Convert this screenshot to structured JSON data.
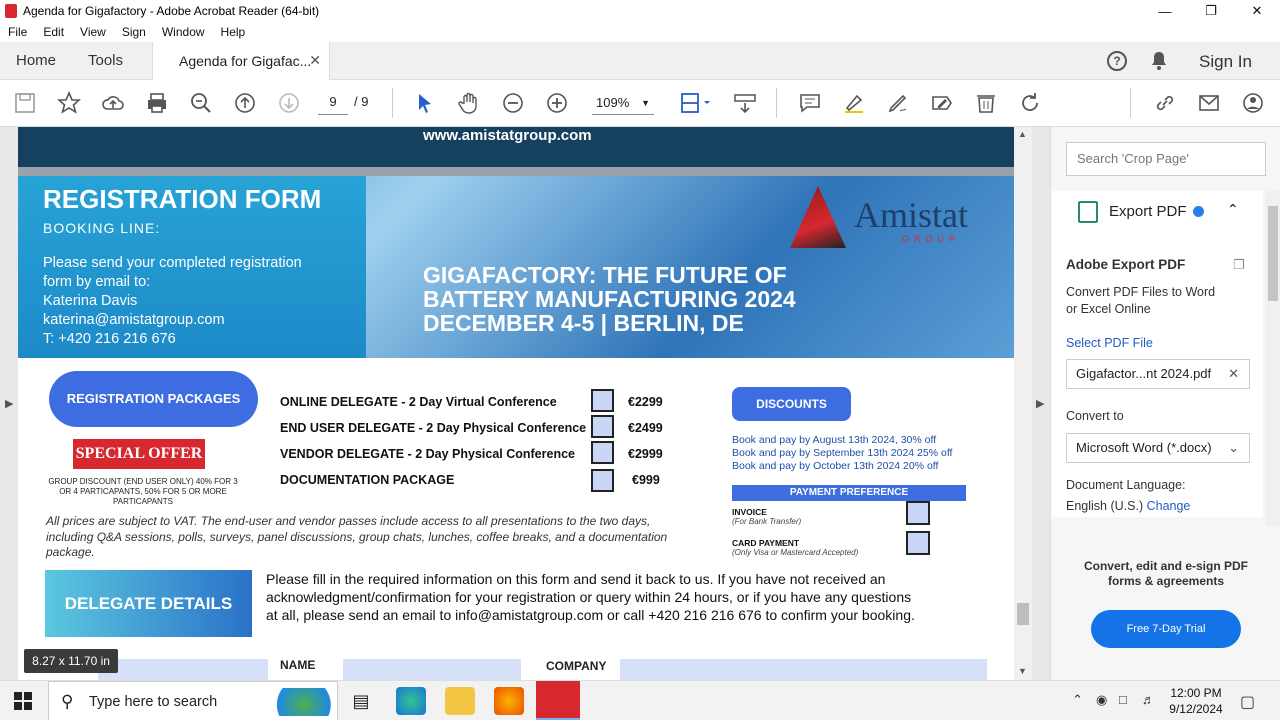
{
  "window": {
    "title": "Agenda for Gigafactory - Adobe Acrobat Reader (64-bit)"
  },
  "menu": [
    "File",
    "Edit",
    "View",
    "Sign",
    "Window",
    "Help"
  ],
  "tabs": {
    "home": "Home",
    "tools": "Tools",
    "doc": "Agenda for Gigafac...",
    "sign_in": "Sign In"
  },
  "toolbar": {
    "page_current": "9",
    "page_total": "/ 9",
    "zoom": "109%"
  },
  "document": {
    "url": "www.amistatgroup.com",
    "reg_title": "REGISTRATION FORM",
    "booking_line": "BOOKING LINE:",
    "contact_lines": [
      "Please send your completed registration",
      "form by email to:",
      "Katerina Davis",
      "katerina@amistatgroup.com",
      "T: +420 216 216 676"
    ],
    "logo_name": "Amistat",
    "logo_group": "GROUP",
    "event_lines": [
      "GIGAFACTORY: THE FUTURE OF",
      "BATTERY MANUFACTURING 2024",
      "DECEMBER 4-5 | BERLIN, DE"
    ],
    "packages_label": "REGISTRATION PACKAGES",
    "special_offer": "SPECIAL OFFER",
    "special_note": "GROUP DISCOUNT (END USER ONLY) 40% FOR 3 OR 4 PARTICAPANTS, 50% FOR 5 OR MORE PARTICAPANTS",
    "packages": [
      {
        "name": "ONLINE DELEGATE - 2 Day Virtual Conference",
        "price": "€2299"
      },
      {
        "name": "END USER DELEGATE - 2 Day Physical Conference",
        "price": "€2499"
      },
      {
        "name": "VENDOR DELEGATE - 2 Day Physical Conference",
        "price": "€2999"
      },
      {
        "name": "DOCUMENTATION PACKAGE",
        "price": "€999"
      }
    ],
    "discounts_label": "DISCOUNTS",
    "discounts": [
      "Book and pay by August  13th 2024, 30% off",
      "Book and pay by September 13th 2024 25% off",
      "Book and pay by October 13th 2024 20% off"
    ],
    "payment_pref": "PAYMENT PREFERENCE",
    "invoice": "INVOICE",
    "invoice_sub": "(For Bank Transfer)",
    "card": "CARD PAYMENT",
    "card_sub": "(Only Visa or Mastercard Accepted)",
    "vat_note": "All prices are subject to VAT. The end-user and vendor passes include access to all presentations to the two days, including Q&A sessions, polls, surveys, panel discussions, group chats, lunches, coffee breaks, and a documentation package.",
    "delegate_label": "DELEGATE DETAILS",
    "fill_note": "Please fill in the required information on this form and send it back to us. If you have not received an acknowledgment/confirmation for your registration or query within 24 hours, or if you have any questions at all, please send an email to info@amistatgroup.com or call +420 216 216 676 to confirm your booking.",
    "field_name": "NAME",
    "field_company": "COMPANY"
  },
  "page_size": "8.27 x 11.70 in",
  "right_panel": {
    "search_placeholder": "Search 'Crop Page'",
    "export_title": "Export PDF",
    "heading": "Adobe Export PDF",
    "desc_lines": [
      "Convert PDF Files to Word",
      "or Excel Online"
    ],
    "select_file": "Select PDF File",
    "file_name": "Gigafactor...nt 2024.pdf",
    "convert_to": "Convert to",
    "format": "Microsoft Word (*.docx)",
    "doc_lang_label": "Document Language:",
    "doc_lang": "English (U.S.)",
    "change": "Change",
    "promo_lines": [
      "Convert, edit and e-sign PDF",
      "forms & agreements"
    ],
    "trial": "Free 7-Day Trial"
  },
  "taskbar": {
    "search_placeholder": "Type here to search",
    "time": "12:00 PM",
    "date": "9/12/2024"
  },
  "colors": {
    "accent": "#3d6de0",
    "adobe_red": "#d7282f",
    "header_navy": "#15415f"
  }
}
